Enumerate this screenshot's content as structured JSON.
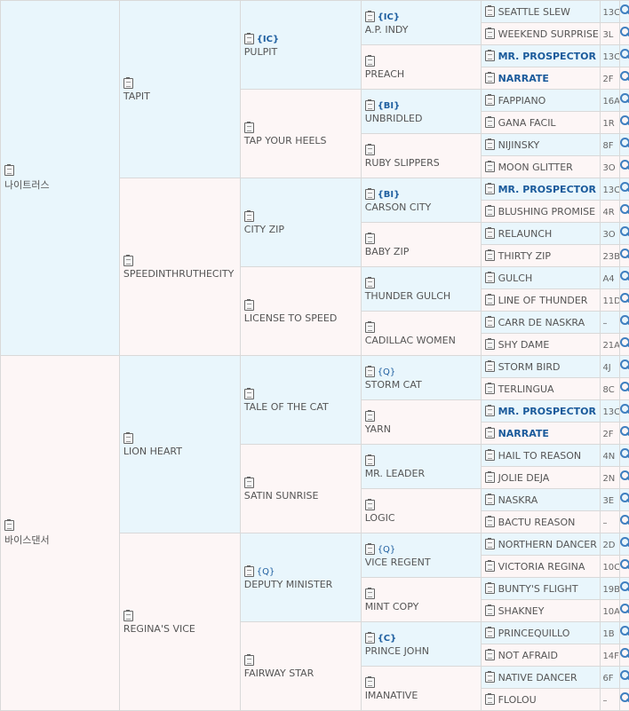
{
  "gen1": [
    {
      "name": "나이트러스",
      "tag": ""
    },
    {
      "name": "바이스댄서",
      "tag": ""
    }
  ],
  "gen2": [
    {
      "name": "TAPIT",
      "tag": ""
    },
    {
      "name": "SPEEDINTHRUTHECITY",
      "tag": ""
    },
    {
      "name": "LION HEART",
      "tag": ""
    },
    {
      "name": "REGINA'S VICE",
      "tag": ""
    }
  ],
  "gen3": [
    {
      "name": "PULPIT",
      "tag": "{IC}"
    },
    {
      "name": "TAP YOUR HEELS",
      "tag": ""
    },
    {
      "name": "CITY ZIP",
      "tag": ""
    },
    {
      "name": "LICENSE TO SPEED",
      "tag": ""
    },
    {
      "name": "TALE OF THE CAT",
      "tag": ""
    },
    {
      "name": "SATIN SUNRISE",
      "tag": ""
    },
    {
      "name": "DEPUTY MINISTER",
      "tag": "{Q}"
    },
    {
      "name": "FAIRWAY STAR",
      "tag": ""
    }
  ],
  "gen4": [
    {
      "name": "A.P. INDY",
      "tag": "{IC}"
    },
    {
      "name": "PREACH",
      "tag": ""
    },
    {
      "name": "UNBRIDLED",
      "tag": "{BI}"
    },
    {
      "name": "RUBY SLIPPERS",
      "tag": ""
    },
    {
      "name": "CARSON CITY",
      "tag": "{BI}"
    },
    {
      "name": "BABY ZIP",
      "tag": ""
    },
    {
      "name": "THUNDER GULCH",
      "tag": ""
    },
    {
      "name": "CADILLAC WOMEN",
      "tag": ""
    },
    {
      "name": "STORM CAT",
      "tag": "{Q}"
    },
    {
      "name": "YARN",
      "tag": ""
    },
    {
      "name": "MR. LEADER",
      "tag": ""
    },
    {
      "name": "LOGIC",
      "tag": ""
    },
    {
      "name": "VICE REGENT",
      "tag": "{Q}"
    },
    {
      "name": "MINT COPY",
      "tag": ""
    },
    {
      "name": "PRINCE JOHN",
      "tag": "{C}"
    },
    {
      "name": "IMANATIVE",
      "tag": ""
    }
  ],
  "gen5": [
    {
      "name": "SEATTLE SLEW",
      "code": "13C"
    },
    {
      "name": "WEEKEND SURPRISE",
      "code": "3L"
    },
    {
      "name": "MR. PROSPECTOR",
      "code": "13C"
    },
    {
      "name": "NARRATE",
      "code": "2F"
    },
    {
      "name": "FAPPIANO",
      "code": "16A"
    },
    {
      "name": "GANA FACIL",
      "code": "1R"
    },
    {
      "name": "NIJINSKY",
      "code": "8F"
    },
    {
      "name": "MOON GLITTER",
      "code": "3O"
    },
    {
      "name": "MR. PROSPECTOR",
      "code": "13C"
    },
    {
      "name": "BLUSHING PROMISE",
      "code": "4R"
    },
    {
      "name": "RELAUNCH",
      "code": "3O"
    },
    {
      "name": "THIRTY ZIP",
      "code": "23B"
    },
    {
      "name": "GULCH",
      "code": "A4"
    },
    {
      "name": "LINE OF THUNDER",
      "code": "11D"
    },
    {
      "name": "CARR DE NASKRA",
      "code": "–"
    },
    {
      "name": "SHY DAME",
      "code": "21A"
    },
    {
      "name": "STORM BIRD",
      "code": "4J"
    },
    {
      "name": "TERLINGUA",
      "code": "8C"
    },
    {
      "name": "MR. PROSPECTOR",
      "code": "13C"
    },
    {
      "name": "NARRATE",
      "code": "2F"
    },
    {
      "name": "HAIL TO REASON",
      "code": "4N"
    },
    {
      "name": "JOLIE DEJA",
      "code": "2N"
    },
    {
      "name": "NASKRA",
      "code": "3E"
    },
    {
      "name": "BACTU REASON",
      "code": "–"
    },
    {
      "name": "NORTHERN DANCER",
      "code": "2D"
    },
    {
      "name": "VICTORIA REGINA",
      "code": "10C"
    },
    {
      "name": "BUNTY'S FLIGHT",
      "code": "19B"
    },
    {
      "name": "SHAKNEY",
      "code": "10A"
    },
    {
      "name": "PRINCEQUILLO",
      "code": "1B"
    },
    {
      "name": "NOT AFRAID",
      "code": "14F"
    },
    {
      "name": "NATIVE DANCER",
      "code": "6F"
    },
    {
      "name": "FLOLOU",
      "code": "–"
    }
  ],
  "highlight": [
    "MR. PROSPECTOR",
    "NARRATE"
  ]
}
